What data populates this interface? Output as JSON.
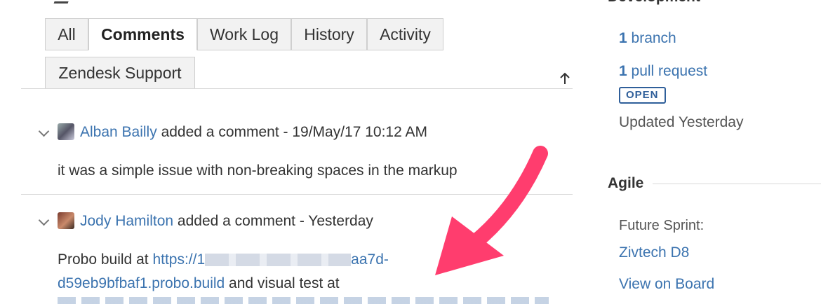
{
  "tabs": {
    "all": "All",
    "comments": "Comments",
    "work_log": "Work Log",
    "history": "History",
    "activity": "Activity",
    "zendesk": "Zendesk Support"
  },
  "sidebar": {
    "development": {
      "title": "Development",
      "branch_count": "1",
      "branch_label": "branch",
      "pr_count": "1",
      "pr_label": "pull request",
      "pr_status": "OPEN",
      "updated": "Updated Yesterday"
    },
    "agile": {
      "title": "Agile",
      "sprint_label": "Future Sprint:",
      "sprint_value": "Zivtech D8",
      "view_on_board": "View on Board"
    }
  },
  "comments": [
    {
      "author": "Alban Bailly",
      "meta": "added a comment - 19/May/17 10:12 AM",
      "body": "it was a simple issue with non-breaking spaces in the markup"
    },
    {
      "author": "Jody Hamilton",
      "meta": "added a comment - Yesterday",
      "body_prefix": "Probo build at ",
      "link_start": "https://1",
      "link_end": "aa7d-",
      "link_line2": "d59eb9bfbaf1.probo.build",
      "body_suffix": " and visual test at"
    }
  ],
  "colors": {
    "link": "#3b73af",
    "arrow": "#ff3d6e",
    "badge": "#2f5f9a"
  }
}
